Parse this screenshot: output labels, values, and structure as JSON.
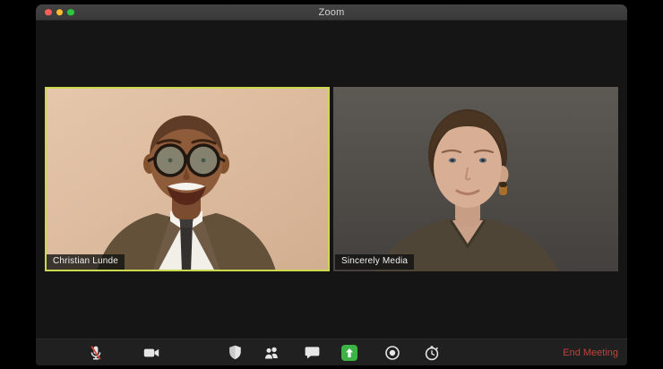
{
  "window": {
    "title": "Zoom"
  },
  "tiles": [
    {
      "name": "Christian Lunde",
      "active_speaker": true
    },
    {
      "name": "Sincerely Media",
      "active_speaker": false
    }
  ],
  "toolbar": {
    "icons": [
      "microphone-muted",
      "video-camera",
      "security-shield",
      "participants",
      "chat",
      "share-screen",
      "record",
      "timer"
    ],
    "end_meeting_label": "End Meeting"
  },
  "colors": {
    "active_speaker_border": "#ccd94e",
    "share_screen_green": "#3cb344",
    "end_meeting_red": "#c0443c",
    "traffic_red": "#ff5f57",
    "traffic_yellow": "#febc2e",
    "traffic_green": "#28c840",
    "titlebar": "#3d3d3d",
    "toolbar": "#202020",
    "window_background": "#151515"
  }
}
